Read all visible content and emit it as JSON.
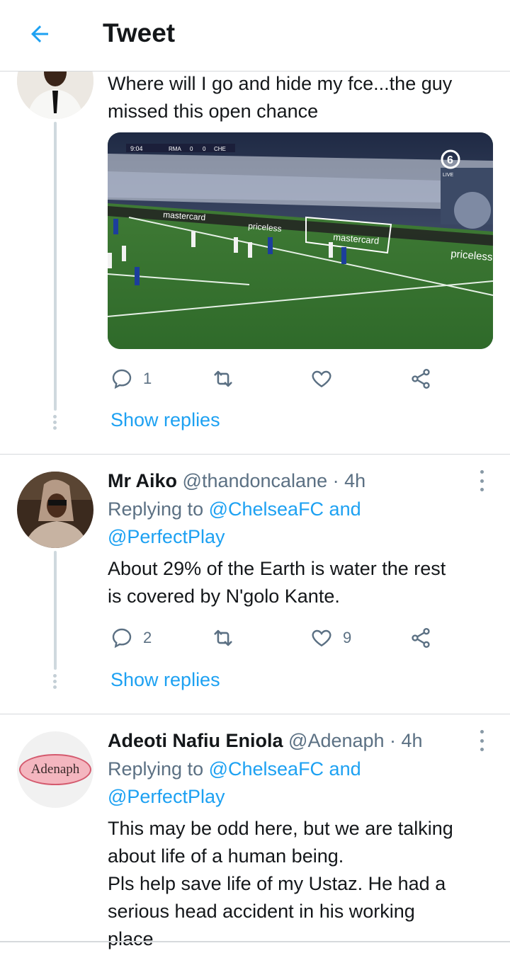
{
  "header": {
    "title": "Tweet"
  },
  "tweets": [
    {
      "text": "Where will I go and hide my fce...the guy\nmissed this open chance",
      "media": {
        "scoreboard": {
          "time": "9:04",
          "home": "RMA",
          "home_score": "0",
          "away_score": "0",
          "away": "CHE"
        },
        "channel": "6",
        "channel_sub": "LIVE",
        "boards": [
          "mastercard",
          "priceless",
          "mastercard",
          "priceless"
        ]
      },
      "actions": {
        "replies": "1",
        "retweets": "",
        "likes": ""
      },
      "show_replies": "Show replies"
    },
    {
      "name": "Mr Aiko",
      "handle": "@thandoncalane · 4h",
      "replying_prefix": "Replying to ",
      "replying_to_1": "@ChelseaFC and",
      "replying_to_2": "@PerfectPlay",
      "text": "About 29% of the Earth is water the rest\nis covered by N'golo Kante.",
      "actions": {
        "replies": "2",
        "retweets": "",
        "likes": "9"
      },
      "show_replies": "Show replies"
    },
    {
      "name": "Adeoti Nafiu Eniola",
      "handle": "@Adenaph · 4h",
      "avatar_text": "Adenaph",
      "replying_prefix": "Replying to ",
      "replying_to_1": "@ChelseaFC and",
      "replying_to_2": "@PerfectPlay",
      "text": "This may be odd here, but we are talking\nabout life of a human being.\nPls help save life of my Ustaz. He had a\nserious head accident in his working\nplace"
    }
  ],
  "colors": {
    "accent": "#1da1f2",
    "secondary": "#5b7083",
    "divider": "#d6d9dc"
  }
}
